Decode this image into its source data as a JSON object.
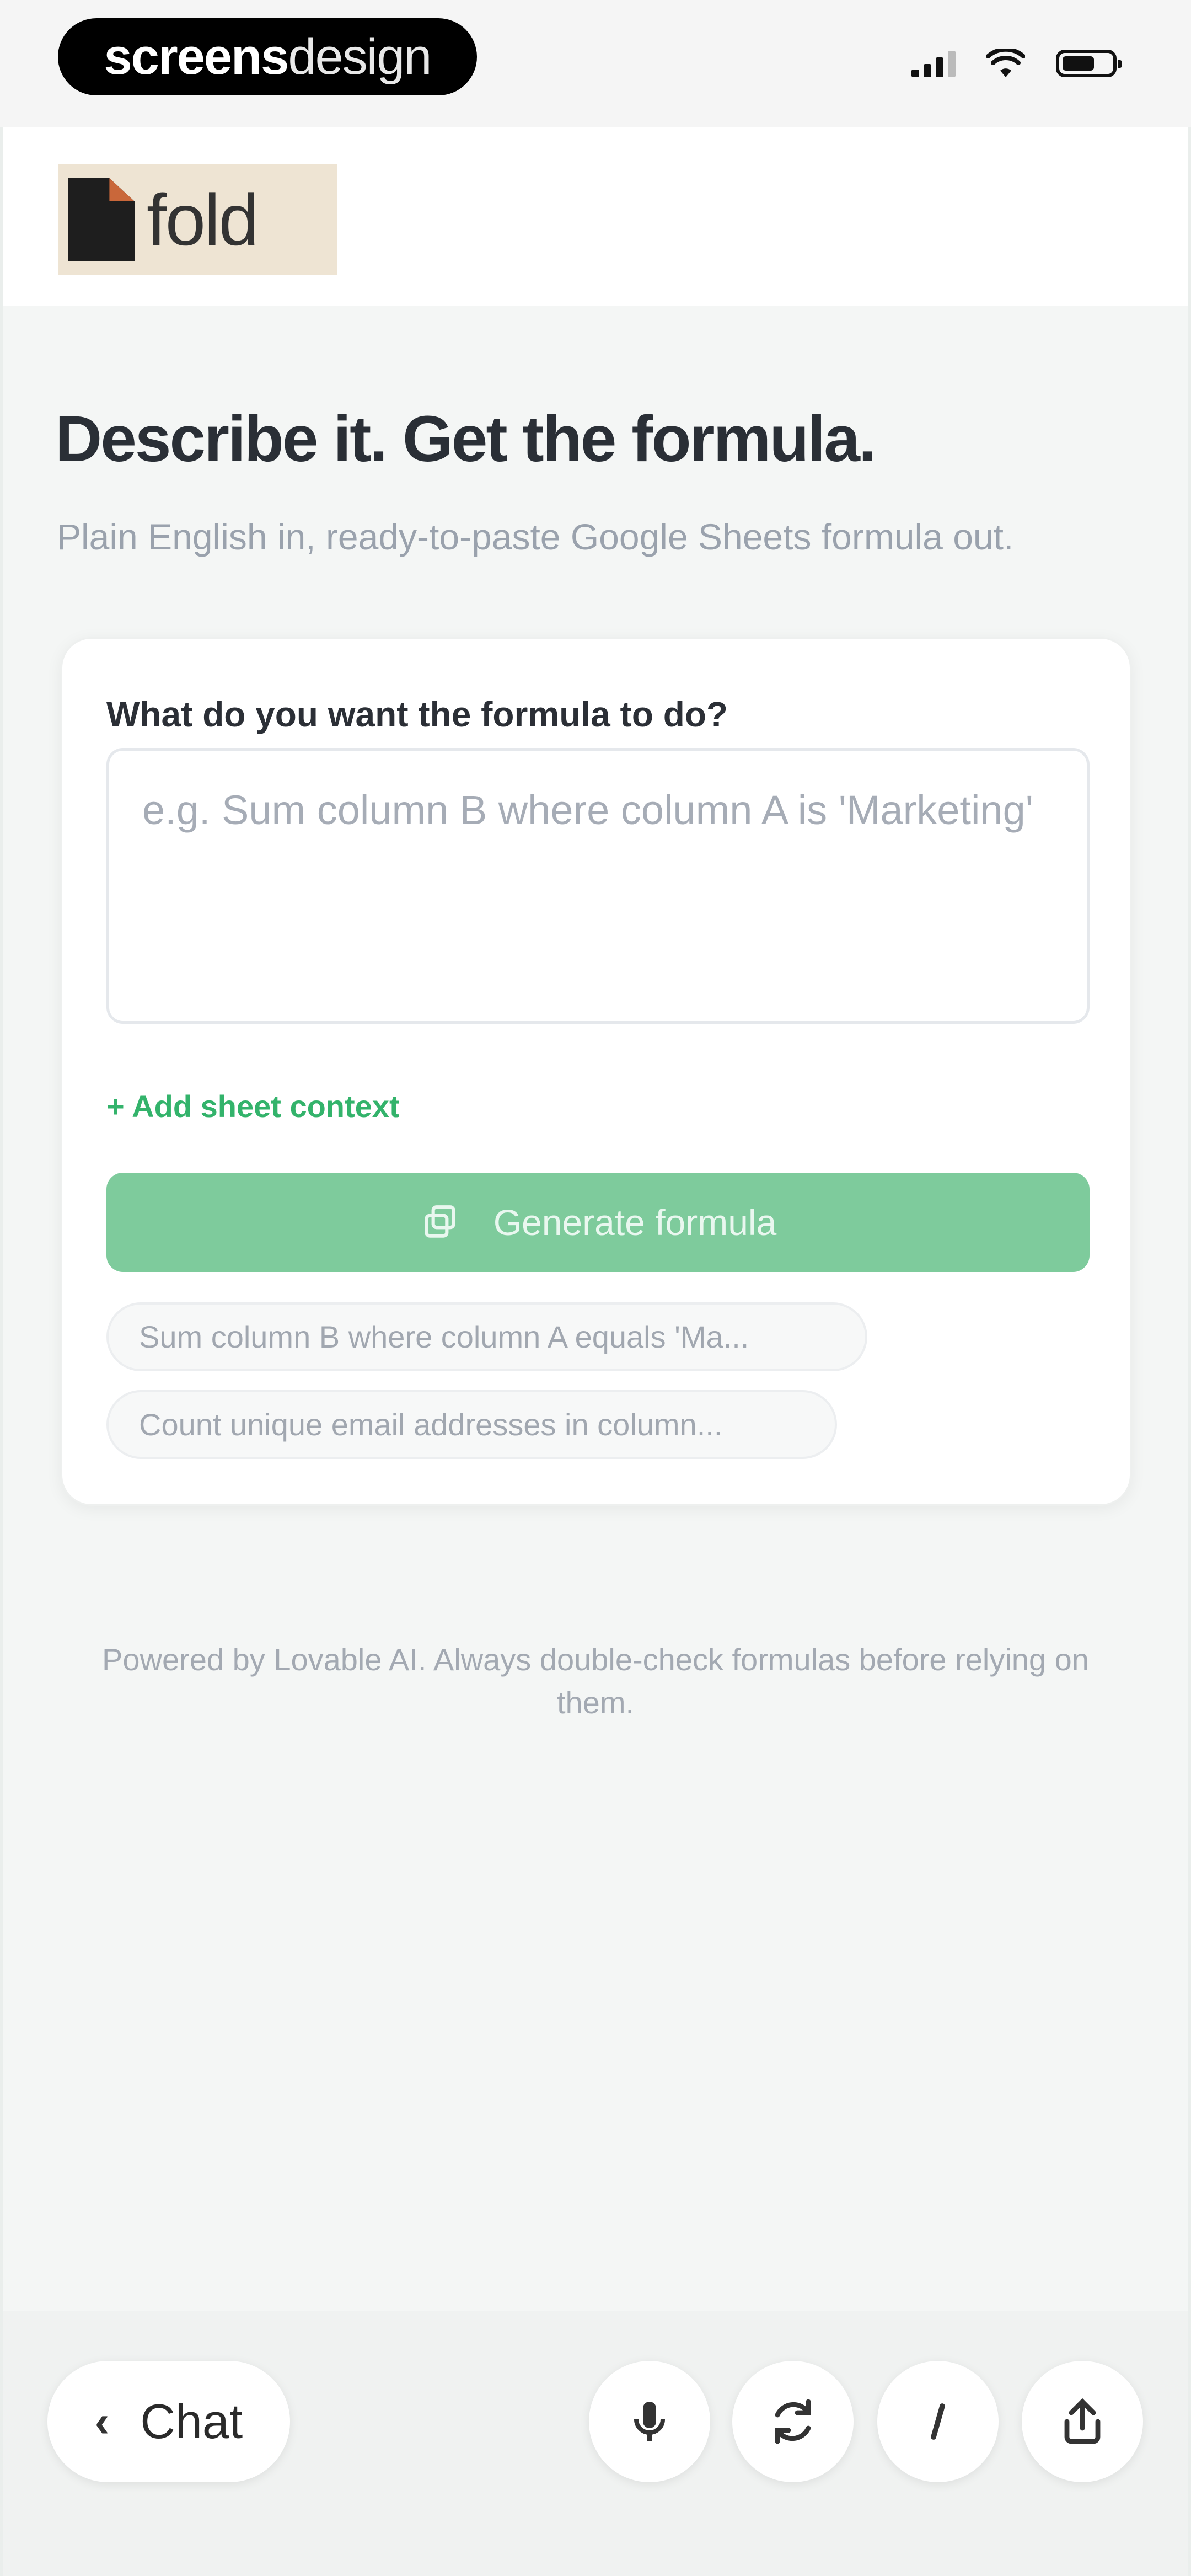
{
  "watermark": {
    "part1": "screens",
    "part2": "design"
  },
  "header": {
    "logo_text": "fold"
  },
  "main": {
    "title": "Describe it. Get the formula.",
    "subtitle": "Plain English in, ready-to-paste Google Sheets formula out."
  },
  "form": {
    "label": "What do you want the formula to do?",
    "placeholder": "e.g. Sum column B where column A is 'Marketing'",
    "value": "",
    "add_context": "+ Add sheet context",
    "generate_label": "Generate formula",
    "suggestions": [
      "Sum column B where column A equals 'Ma...",
      "Count unique email addresses in column..."
    ]
  },
  "footer": {
    "note": "Powered by Lovable AI. Always double-check formulas before relying on them."
  },
  "toolbar": {
    "chat_label": "Chat",
    "icons": [
      "microphone-icon",
      "refresh-icon",
      "slash-icon",
      "share-icon"
    ]
  },
  "colors": {
    "accent": "#33b36b",
    "button": "#7ecb9c",
    "background": "#f4f6f5"
  }
}
